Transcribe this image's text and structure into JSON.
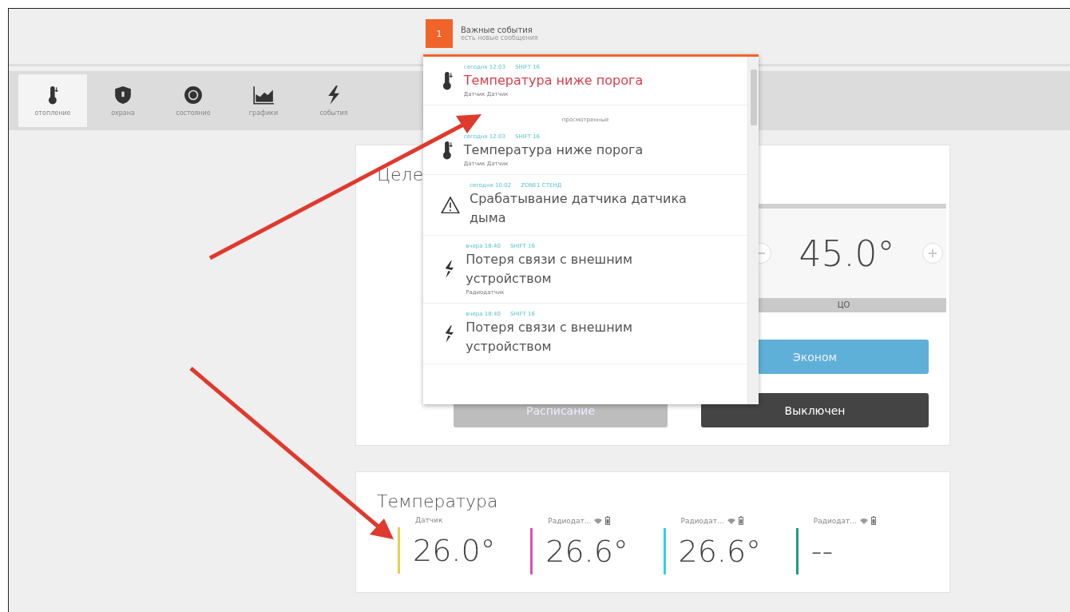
{
  "notifications": {
    "count": "1",
    "title": "Важные события",
    "subtitle": "есть новые сообщения",
    "groups": [
      {
        "items": [
          {
            "kind": "temperature",
            "time": "сегодня 12:03",
            "source": "SHIFT 16",
            "title": "Температура ниже порога",
            "detail": "Датчик Датчик",
            "unread": true
          }
        ]
      },
      {
        "label": "просмотренные",
        "items": [
          {
            "kind": "temperature",
            "time": "сегодня 12:03",
            "source": "SHIFT 16",
            "title": "Температура ниже порога",
            "detail": "Датчик Датчик",
            "unread": false
          },
          {
            "kind": "alarm",
            "time": "сегодня 10:02",
            "source": "ZONE1 СТЕНД",
            "title": "Срабатывание датчика датчика дыма",
            "unread": false
          },
          {
            "kind": "connection",
            "time": "вчера 18:40",
            "source": "SHIFT 16",
            "title": "Потеря связи с внешним устройством",
            "detail": "Радиодатчик",
            "unread": false
          },
          {
            "kind": "connection",
            "time": "вчера 18:40",
            "source": "SHIFT 16",
            "title": "Потеря связи с внешним устройством",
            "unread": false
          }
        ]
      }
    ]
  },
  "tabs": [
    {
      "label": "отопление",
      "selected": true
    },
    {
      "label": "охрана",
      "selected": false
    },
    {
      "label": "состояние",
      "selected": false
    },
    {
      "label": "графики",
      "selected": false
    },
    {
      "label": "события",
      "selected": false
    }
  ],
  "heating": {
    "title": "Целе",
    "setpoint": "45.0°",
    "setpoint_label": "ЦО",
    "modes": [
      {
        "kind": "blue",
        "label": "Эконом"
      },
      {
        "kind": "grey",
        "label": "Расписание"
      },
      {
        "kind": "dark",
        "label": "Выключен"
      }
    ]
  },
  "temperature": {
    "title": "Температура",
    "sensors": [
      {
        "name": "Датчик",
        "value": "26.0°",
        "color": "#e6cf4a",
        "kind": "wired"
      },
      {
        "name": "Радиодат...",
        "value": "26.6°",
        "color": "#e04fb0",
        "kind": "radio"
      },
      {
        "name": "Радиодат...",
        "value": "26.6°",
        "color": "#2fd3da",
        "kind": "radio"
      },
      {
        "name": "Радиодат...",
        "value": "--",
        "color": "#1f9c88",
        "kind": "radio"
      }
    ]
  }
}
